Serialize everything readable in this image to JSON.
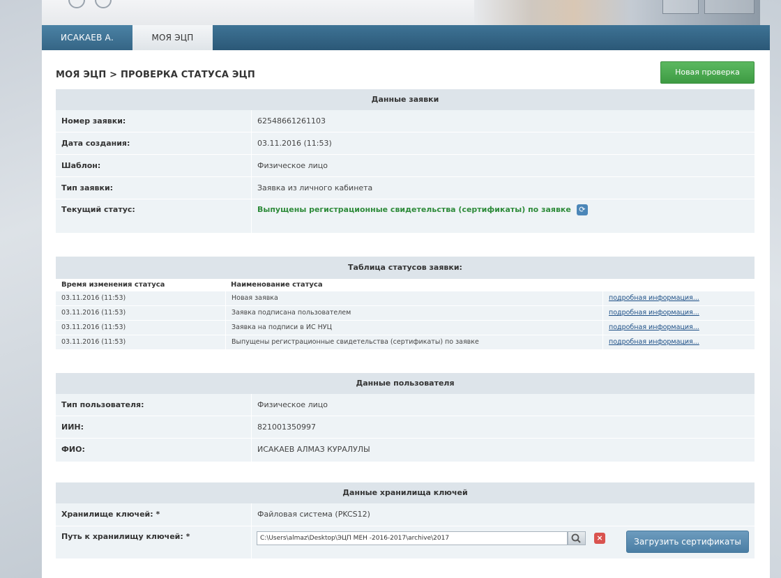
{
  "tabs": [
    {
      "label": "Исакаев А."
    },
    {
      "label": "Моя ЭЦП"
    }
  ],
  "breadcrumb": "МОЯ ЭЦП > ПРОВЕРКА СТАТУСА ЭЦП",
  "new_check_button": "Новая проверка",
  "application": {
    "title": "Данные заявки",
    "rows": [
      {
        "label": "Номер заявки:",
        "value": "62548661261103"
      },
      {
        "label": "Дата создания:",
        "value": "03.11.2016 (11:53)"
      },
      {
        "label": "Шаблон:",
        "value": "Физическое лицо"
      },
      {
        "label": "Тип заявки:",
        "value": "Заявка из личного кабинета"
      },
      {
        "label": "Текущий статус:",
        "value": "Выпущены регистрационные свидетельства (сертификаты) по заявке"
      }
    ]
  },
  "status_table": {
    "title": "Таблица статусов заявки:",
    "col_time": "Время изменения статуса",
    "col_name": "Наименование статуса",
    "rows": [
      {
        "time": "03.11.2016 (11:53)",
        "name": "Новая заявка",
        "link": "подробная информация..."
      },
      {
        "time": "03.11.2016 (11:53)",
        "name": "Заявка подписана пользователем",
        "link": "подробная информация..."
      },
      {
        "time": "03.11.2016 (11:53)",
        "name": "Заявка на подписи в ИС НУЦ",
        "link": "подробная информация..."
      },
      {
        "time": "03.11.2016 (11:53)",
        "name": "Выпущены регистрационные свидетельства (сертификаты) по заявке",
        "link": "подробная информация..."
      }
    ]
  },
  "user": {
    "title": "Данные пользователя",
    "rows": [
      {
        "label": "Тип пользователя:",
        "value": "Физическое лицо"
      },
      {
        "label": "ИИН:",
        "value": "821001350997"
      },
      {
        "label": "ФИО:",
        "value": "ИСАКАЕВ АЛМАЗ КУРАЛУЛЫ"
      }
    ]
  },
  "keystore": {
    "title": "Данные хранилища ключей",
    "storage_label": "Хранилище ключей: *",
    "storage_value": "Файловая система (PKCS12)",
    "path_label": "Путь к хранилищу ключей: *",
    "path_value": "C:\\Users\\almaz\\Desktop\\ЭЦП МЕН -2016-2017\\archive\\2017",
    "upload_button": "Загрузить сертификаты"
  },
  "colors": {
    "green_status": "#2e8b3a",
    "header_blue": "#2b5877",
    "button_green": "#3e9b43",
    "button_blue": "#4a7ea4"
  }
}
